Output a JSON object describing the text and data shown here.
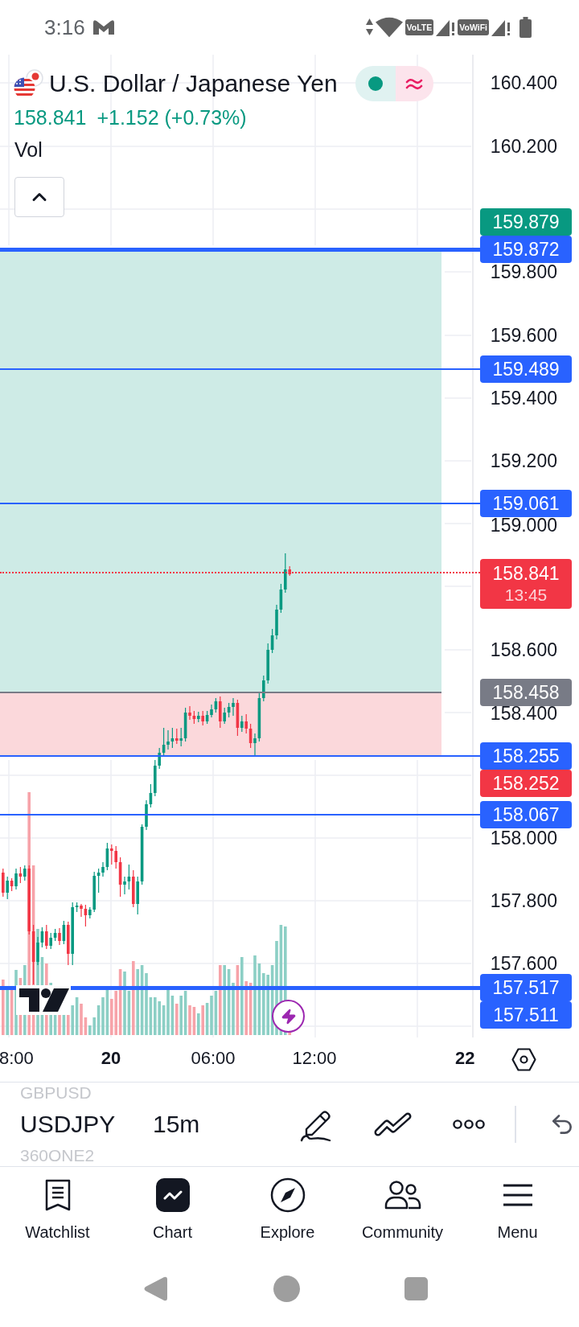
{
  "status_bar": {
    "time": "3:16",
    "badges": [
      "VoLTE",
      "VoWiFi"
    ]
  },
  "legend": {
    "title": "U.S. Dollar / Japanese Yen",
    "price": "158.841",
    "change": "+1.152 (+0.73%)",
    "indicator": "Vol"
  },
  "price_axis": {
    "ticks": [
      "160.400",
      "160.200",
      "159.800",
      "159.600",
      "159.400",
      "159.200",
      "159.000",
      "158.600",
      "158.400",
      "158.000",
      "157.800",
      "157.600"
    ],
    "tags": [
      {
        "value": "159.879",
        "color": "#089981",
        "kind": "plain"
      },
      {
        "value": "159.872",
        "color": "#2962ff",
        "kind": "thick"
      },
      {
        "value": "159.489",
        "color": "#2962ff",
        "kind": "thin"
      },
      {
        "value": "159.061",
        "color": "#2962ff",
        "kind": "thin"
      },
      {
        "value": "158.841",
        "countdown": "13:45",
        "color": "#f23645",
        "kind": "dotted"
      },
      {
        "value": "158.458",
        "color": "#787b86",
        "kind": "zone"
      },
      {
        "value": "158.255",
        "color": "#2962ff",
        "kind": "thin"
      },
      {
        "value": "158.252",
        "color": "#f23645",
        "kind": "plain"
      },
      {
        "value": "158.067",
        "color": "#2962ff",
        "kind": "thin"
      },
      {
        "value": "157.517",
        "color": "#2962ff",
        "kind": "thick"
      },
      {
        "value": "157.511",
        "color": "#2962ff",
        "kind": "plain"
      }
    ]
  },
  "time_axis": {
    "labels": [
      {
        "text": "8:00",
        "bold": false
      },
      {
        "text": "20",
        "bold": true
      },
      {
        "text": "06:00",
        "bold": false
      },
      {
        "text": "12:00",
        "bold": false
      },
      {
        "text": "22",
        "bold": true
      }
    ]
  },
  "toolbar": {
    "symbols": [
      {
        "label": "GBPUSD",
        "selected": false
      },
      {
        "label": "USDJPY",
        "selected": true
      },
      {
        "label": "360ONE2",
        "selected": false
      }
    ],
    "interval": "15m"
  },
  "nav": [
    {
      "label": "Watchlist",
      "selected": false
    },
    {
      "label": "Chart",
      "selected": true
    },
    {
      "label": "Explore",
      "selected": false
    },
    {
      "label": "Community",
      "selected": false
    },
    {
      "label": "Menu",
      "selected": false
    }
  ]
}
